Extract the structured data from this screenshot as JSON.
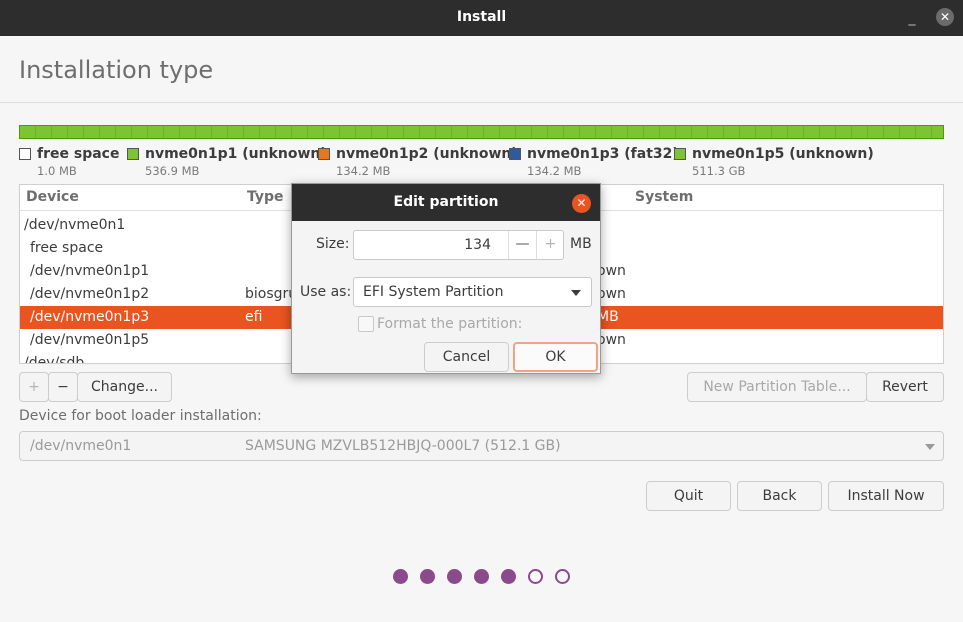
{
  "window": {
    "title": "Install",
    "minimize_glyph": "_",
    "close_glyph": "✕"
  },
  "page": {
    "title": "Installation type"
  },
  "disk_legend": [
    {
      "name": "free space",
      "size": "1.0 MB",
      "color": "#ffffff"
    },
    {
      "name": "nvme0n1p1 (unknown)",
      "size": "536.9 MB",
      "color": "#7cc431"
    },
    {
      "name": "nvme0n1p2 (unknown)",
      "size": "134.2 MB",
      "color": "#e8761c"
    },
    {
      "name": "nvme0n1p3 (fat32)",
      "size": "134.2 MB",
      "color": "#2e5aa0"
    },
    {
      "name": "nvme0n1p5 (unknown)",
      "size": "511.3 GB",
      "color": "#7cc431"
    }
  ],
  "table": {
    "columns": {
      "device": "Device",
      "type": "Type",
      "system": "System"
    },
    "rows": [
      {
        "device": "/dev/nvme0n1",
        "type": "",
        "right": ""
      },
      {
        "device": "free space",
        "type": "",
        "right": ""
      },
      {
        "device": "/dev/nvme0n1p1",
        "type": "",
        "right": "own"
      },
      {
        "device": "/dev/nvme0n1p2",
        "type": "biosgru",
        "right": "own"
      },
      {
        "device": "/dev/nvme0n1p3",
        "type": "efi",
        "right": "MB",
        "selected": true
      },
      {
        "device": "/dev/nvme0n1p5",
        "type": "",
        "right": "own"
      },
      {
        "device": "/dev/sdb",
        "type": "",
        "right": ""
      }
    ]
  },
  "table_buttons": {
    "add": "+",
    "remove": "−",
    "change": "Change...",
    "new_partition_table": "New Partition Table...",
    "revert": "Revert"
  },
  "bootloader": {
    "label": "Device for boot loader installation:",
    "device": "/dev/nvme0n1",
    "model": "SAMSUNG MZVLB512HBJQ-000L7 (512.1 GB)"
  },
  "nav_buttons": {
    "quit": "Quit",
    "back": "Back",
    "install_now": "Install Now"
  },
  "progress": {
    "completed_steps": 5,
    "total_steps": 7
  },
  "dialog": {
    "title": "Edit partition",
    "close_glyph": "✕",
    "size_label": "Size:",
    "size_value": "134",
    "size_minus": "—",
    "size_plus": "+",
    "size_unit": "MB",
    "use_as_label": "Use as:",
    "use_as_value": "EFI System Partition",
    "format_label": "Format the partition:",
    "cancel": "Cancel",
    "ok": "OK"
  },
  "colors": {
    "accent": "#e95420",
    "titlebar": "#2d2d2d",
    "progress_dot": "#8a4a8b"
  }
}
